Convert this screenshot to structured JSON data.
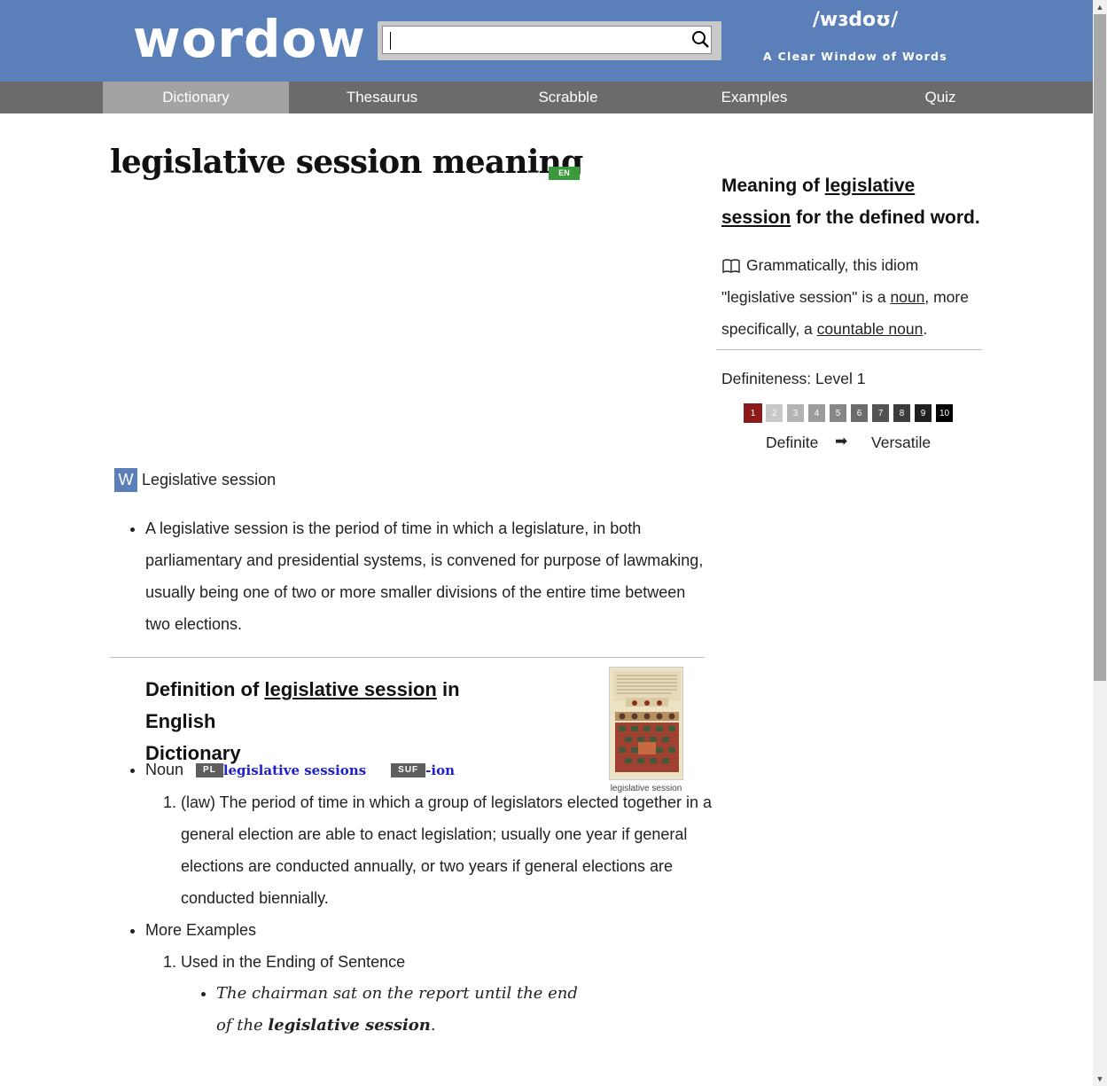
{
  "header": {
    "logo": "wordow",
    "search_placeholder": "",
    "ipa": "/wɜdoʊ/",
    "tagline": "A Clear Window of Words",
    "brand_color": "#5b7fb8"
  },
  "nav": {
    "items": [
      {
        "label": "Dictionary",
        "active": true
      },
      {
        "label": "Thesaurus"
      },
      {
        "label": "Scrabble"
      },
      {
        "label": "Examples"
      },
      {
        "label": "Quiz"
      }
    ]
  },
  "main": {
    "title": "legislative session meaning",
    "lang_badge": "EN",
    "wiki": {
      "icon_letter": "W",
      "title": "Legislative session",
      "definition": "A legislative session is the period of time in which a legislature, in both parliamentary and presidential systems, is convened for purpose of lawmaking, usually being one of two or more smaller divisions of the entire time between two elections."
    },
    "definition": {
      "title_prefix": "Definition of ",
      "title_word": "legislative session",
      "title_mid": " in English",
      "title_suffix": "Dictionary",
      "image_caption": "legislative session",
      "pos": "Noun",
      "plural_tag": "PL",
      "plural_form": "legislative sessions",
      "suffix_tag": "SUF",
      "suffix_form": "-ion",
      "senses": [
        "(law) The period of time in which a group of legislators elected together in a general election are able to enact legislation; usually one year if general elections are conducted annually, or two years if general elections are conducted biennially."
      ],
      "more_examples_label": "More Examples",
      "example_group": "Used in the Ending of Sentence",
      "example_before": "The chairman sat on the report until the end of the ",
      "example_bold": "legislative session",
      "example_after": "."
    }
  },
  "sidebar": {
    "title_prefix": "Meaning of ",
    "title_word": "legislative session",
    "title_suffix": " for the defined word.",
    "grammar_prefix": "Grammatically, this idiom \"legislative session\" is a ",
    "grammar_noun": "noun",
    "grammar_mid": ", more specifically, a ",
    "grammar_countable": "countable noun",
    "grammar_end": ".",
    "definiteness_label": "Definiteness: Level 1",
    "levels": [
      "1",
      "2",
      "3",
      "4",
      "5",
      "6",
      "7",
      "8",
      "9",
      "10"
    ],
    "level_colors": [
      "#8b1a1a",
      "#c8c8c8",
      "#b4b4b4",
      "#9c9c9c",
      "#868686",
      "#6c6c6c",
      "#535353",
      "#3c3c3c",
      "#202020",
      "#000000"
    ],
    "selected_level": 1,
    "scale_left": "Definite",
    "scale_arrow": "➡",
    "scale_right": "Versatile"
  }
}
